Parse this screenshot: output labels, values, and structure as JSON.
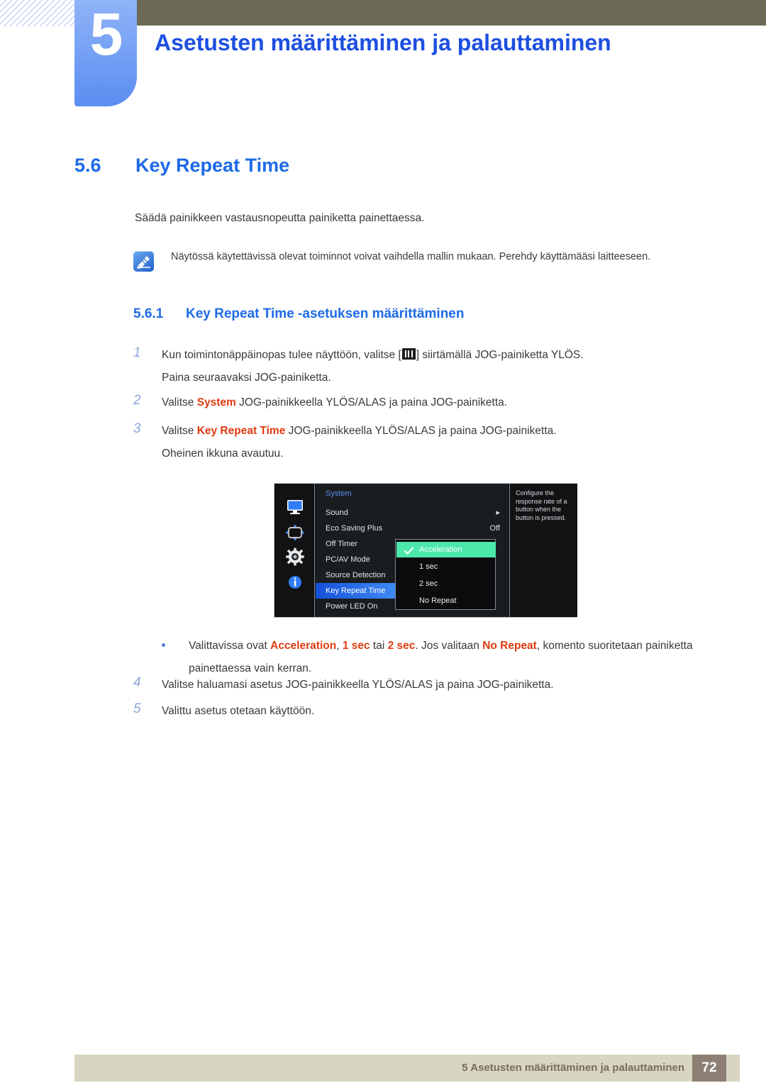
{
  "header": {
    "chapter_number": "5",
    "chapter_title": "Asetusten määrittäminen ja palauttaminen",
    "accent_blue": "#1d4fe0",
    "badge_blue": "#5b8ef2",
    "olive": "#6d6b55"
  },
  "section": {
    "number": "5.6",
    "title": "Key Repeat Time",
    "intro": "Säädä painikkeen vastausnopeutta painiketta painettaessa."
  },
  "note": {
    "icon": "note-pen-icon",
    "text": "Näytössä käytettävissä olevat toiminnot voivat vaihdella mallin mukaan. Perehdy käyttämääsi laitteeseen."
  },
  "subsection": {
    "number": "5.6.1",
    "title": "Key Repeat Time -asetuksen määrittäminen"
  },
  "steps": [
    {
      "num": "1",
      "line1_pre": "Kun toimintonäppäinopas tulee näyttöön, valitse [",
      "line1_post": "] siirtämällä JOG-painiketta YLÖS.",
      "line2": "Paina seuraavaksi JOG-painiketta."
    },
    {
      "num": "2",
      "pre": "Valitse ",
      "bold": "System",
      "post": " JOG-painikkeella YLÖS/ALAS ja paina JOG-painiketta."
    },
    {
      "num": "3",
      "pre": "Valitse ",
      "bold": "Key Repeat Time",
      "post": " JOG-painikkeella YLÖS/ALAS ja paina JOG-painiketta.",
      "line2": "Oheinen ikkuna avautuu."
    },
    {
      "num": "4",
      "text": "Valitse haluamasi asetus JOG-painikkeella YLÖS/ALAS ja paina JOG-painiketta."
    },
    {
      "num": "5",
      "text": "Valittu asetus otetaan käyttöön."
    }
  ],
  "bullet": {
    "t1": "Valittavissa ovat ",
    "b1": "Acceleration",
    "t2": ", ",
    "b2": "1 sec",
    "t3": " tai ",
    "b3": "2 sec",
    "t4": ". Jos valitaan ",
    "b4": "No Repeat",
    "t5": ", komento suoritetaan painiketta painettaessa vain kerran."
  },
  "osd": {
    "icons": [
      "picture-monitor-icon",
      "screen-adjust-icon",
      "system-gear-icon",
      "information-icon"
    ],
    "menu_title": "System",
    "rows": [
      {
        "label": "Sound",
        "value": "▸"
      },
      {
        "label": "Eco Saving Plus",
        "value": "Off"
      },
      {
        "label": "Off Timer",
        "value": ""
      },
      {
        "label": "PC/AV Mode",
        "value": ""
      },
      {
        "label": "Source Detection",
        "value": ""
      },
      {
        "label": "Key Repeat Time",
        "value": ""
      },
      {
        "label": "Power LED On",
        "value": ""
      }
    ],
    "selected_row": "Key Repeat Time",
    "dropdown": {
      "options": [
        "Acceleration",
        "1 sec",
        "2 sec",
        "No Repeat"
      ],
      "selected": "Acceleration",
      "highlight_color": "#4ce8ab"
    },
    "description": "Configure the response rate of a button when the button is pressed."
  },
  "footer": {
    "text": "5 Asetusten määrittäminen ja palauttaminen",
    "page": "72"
  }
}
